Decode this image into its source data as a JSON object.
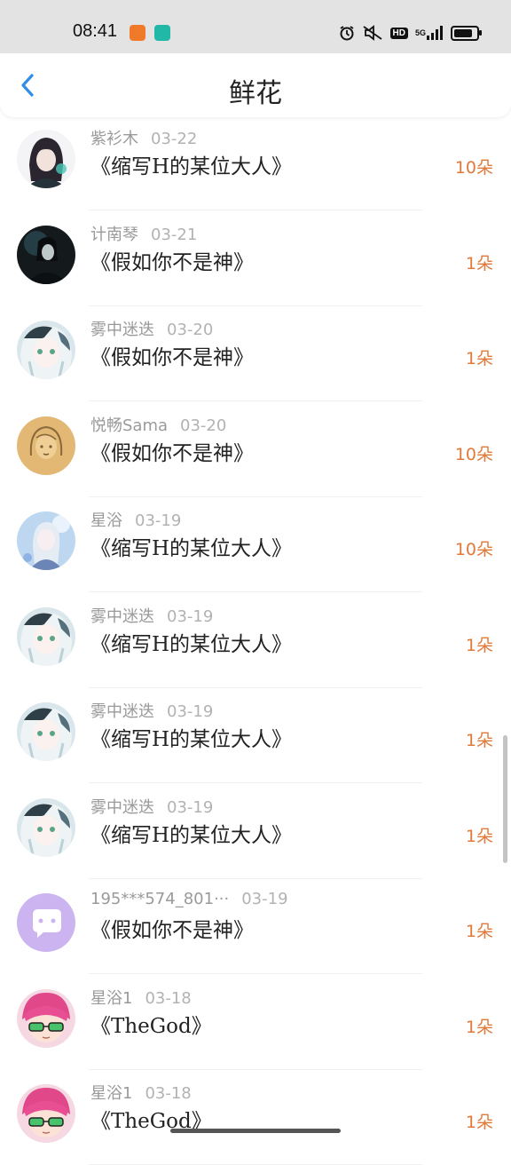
{
  "status_bar": {
    "time": "08:41",
    "icons": [
      "orange-app-icon",
      "teal-app-icon",
      "alarm-icon",
      "mute-icon",
      "hd-icon",
      "5g-signal-icon",
      "battery-icon"
    ],
    "hd": "HD",
    "net": "5G",
    "battery_level": 0.9
  },
  "header": {
    "title": "鲜花",
    "back_icon": "chevron-left-icon",
    "accent_color": "#2f8fe6"
  },
  "colors": {
    "count": "#e07a3a",
    "meta": "#9a9a9a"
  },
  "items": [
    {
      "user": "紫衫木",
      "date": "03-22",
      "work": "《缩写H的某位大人》",
      "count": "10朵",
      "avatar": "dark-hair-anime-avatar"
    },
    {
      "user": "计南琴",
      "date": "03-21",
      "work": "《假如你不是神》",
      "count": "1朵",
      "avatar": "dark-figure-avatar"
    },
    {
      "user": "雾中迷迭",
      "date": "03-20",
      "work": "《假如你不是神》",
      "count": "1朵",
      "avatar": "white-hair-anime-avatar"
    },
    {
      "user": "悦畅Sama",
      "date": "03-20",
      "work": "《假如你不是神》",
      "count": "10朵",
      "avatar": "sketch-girl-avatar"
    },
    {
      "user": "星浴",
      "date": "03-19",
      "work": "《缩写H的某位大人》",
      "count": "10朵",
      "avatar": "blue-anime-avatar"
    },
    {
      "user": "雾中迷迭",
      "date": "03-19",
      "work": "《缩写H的某位大人》",
      "count": "1朵",
      "avatar": "white-hair-anime-avatar"
    },
    {
      "user": "雾中迷迭",
      "date": "03-19",
      "work": "《缩写H的某位大人》",
      "count": "1朵",
      "avatar": "white-hair-anime-avatar"
    },
    {
      "user": "雾中迷迭",
      "date": "03-19",
      "work": "《缩写H的某位大人》",
      "count": "1朵",
      "avatar": "white-hair-anime-avatar"
    },
    {
      "user": "195***574_801···",
      "date": "03-19",
      "work": "《假如你不是神》",
      "count": "1朵",
      "avatar": "default-chat-avatar"
    },
    {
      "user": "星浴1",
      "date": "03-18",
      "work": "《TheGod》",
      "count": "1朵",
      "avatar": "pink-hair-glasses-avatar"
    },
    {
      "user": "星浴1",
      "date": "03-18",
      "work": "《TheGod》",
      "count": "1朵",
      "avatar": "pink-hair-glasses-avatar"
    }
  ]
}
